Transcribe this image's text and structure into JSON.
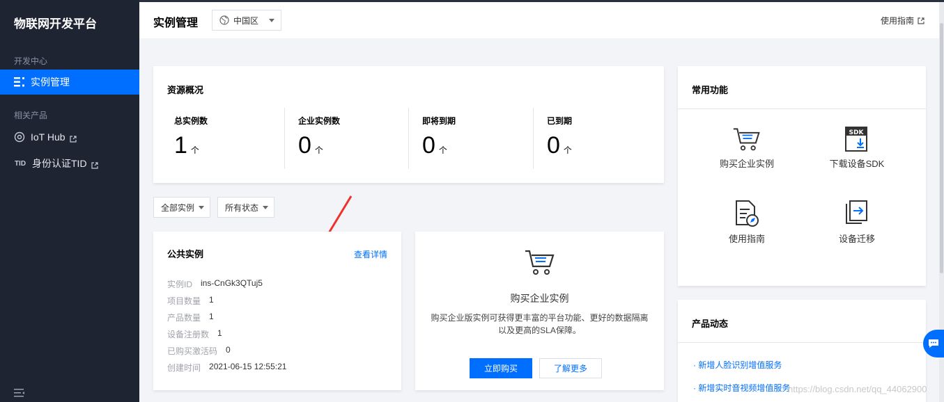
{
  "sidebar": {
    "title": "物联网开发平台",
    "section_dev": "开发中心",
    "items": [
      {
        "label": "实例管理"
      },
      {
        "label": "IoT Hub"
      },
      {
        "label": "身份认证TID"
      }
    ],
    "section_related": "相关产品"
  },
  "header": {
    "title": "实例管理",
    "region": "中国区",
    "guide_link": "使用指南"
  },
  "overview": {
    "title": "资源概况",
    "stats": [
      {
        "label": "总实例数",
        "value": "1",
        "unit": "个"
      },
      {
        "label": "企业实例数",
        "value": "0",
        "unit": "个"
      },
      {
        "label": "即将到期",
        "value": "0",
        "unit": "个"
      },
      {
        "label": "已到期",
        "value": "0",
        "unit": "个"
      }
    ]
  },
  "filters": {
    "instance_type": "全部实例",
    "status": "所有状态"
  },
  "public_instance": {
    "title": "公共实例",
    "detail_link": "查看详情",
    "fields": [
      {
        "k": "实例ID",
        "v": "ins-CnGk3QTuj5"
      },
      {
        "k": "项目数量",
        "v": "1"
      },
      {
        "k": "产品数量",
        "v": "1"
      },
      {
        "k": "设备注册数",
        "v": "1"
      },
      {
        "k": "已购买激活码",
        "v": "0"
      },
      {
        "k": "创建时间",
        "v": "2021-06-15 12:55:21"
      }
    ]
  },
  "buy_card": {
    "title": "购买企业实例",
    "desc_line1": "购买企业版实例可获得更丰富的平台功能、更好的数据隔离",
    "desc_line2": "以及更高的SLA保障。",
    "primary": "立即购买",
    "secondary": "了解更多"
  },
  "common": {
    "title": "常用功能",
    "items": [
      {
        "label": "购买企业实例",
        "icon": "cart-icon"
      },
      {
        "label": "下载设备SDK",
        "icon": "sdk-download-icon"
      },
      {
        "label": "使用指南",
        "icon": "guide-doc-icon"
      },
      {
        "label": "设备迁移",
        "icon": "migrate-icon"
      }
    ]
  },
  "news": {
    "title": "产品动态",
    "items": [
      "新增人脸识别增值服务",
      "新增实时音视频增值服务"
    ]
  },
  "watermark": "https://blog.csdn.net/qq_44062900",
  "colors": {
    "accent": "#006eff",
    "sidebar_bg": "#1f2433"
  }
}
